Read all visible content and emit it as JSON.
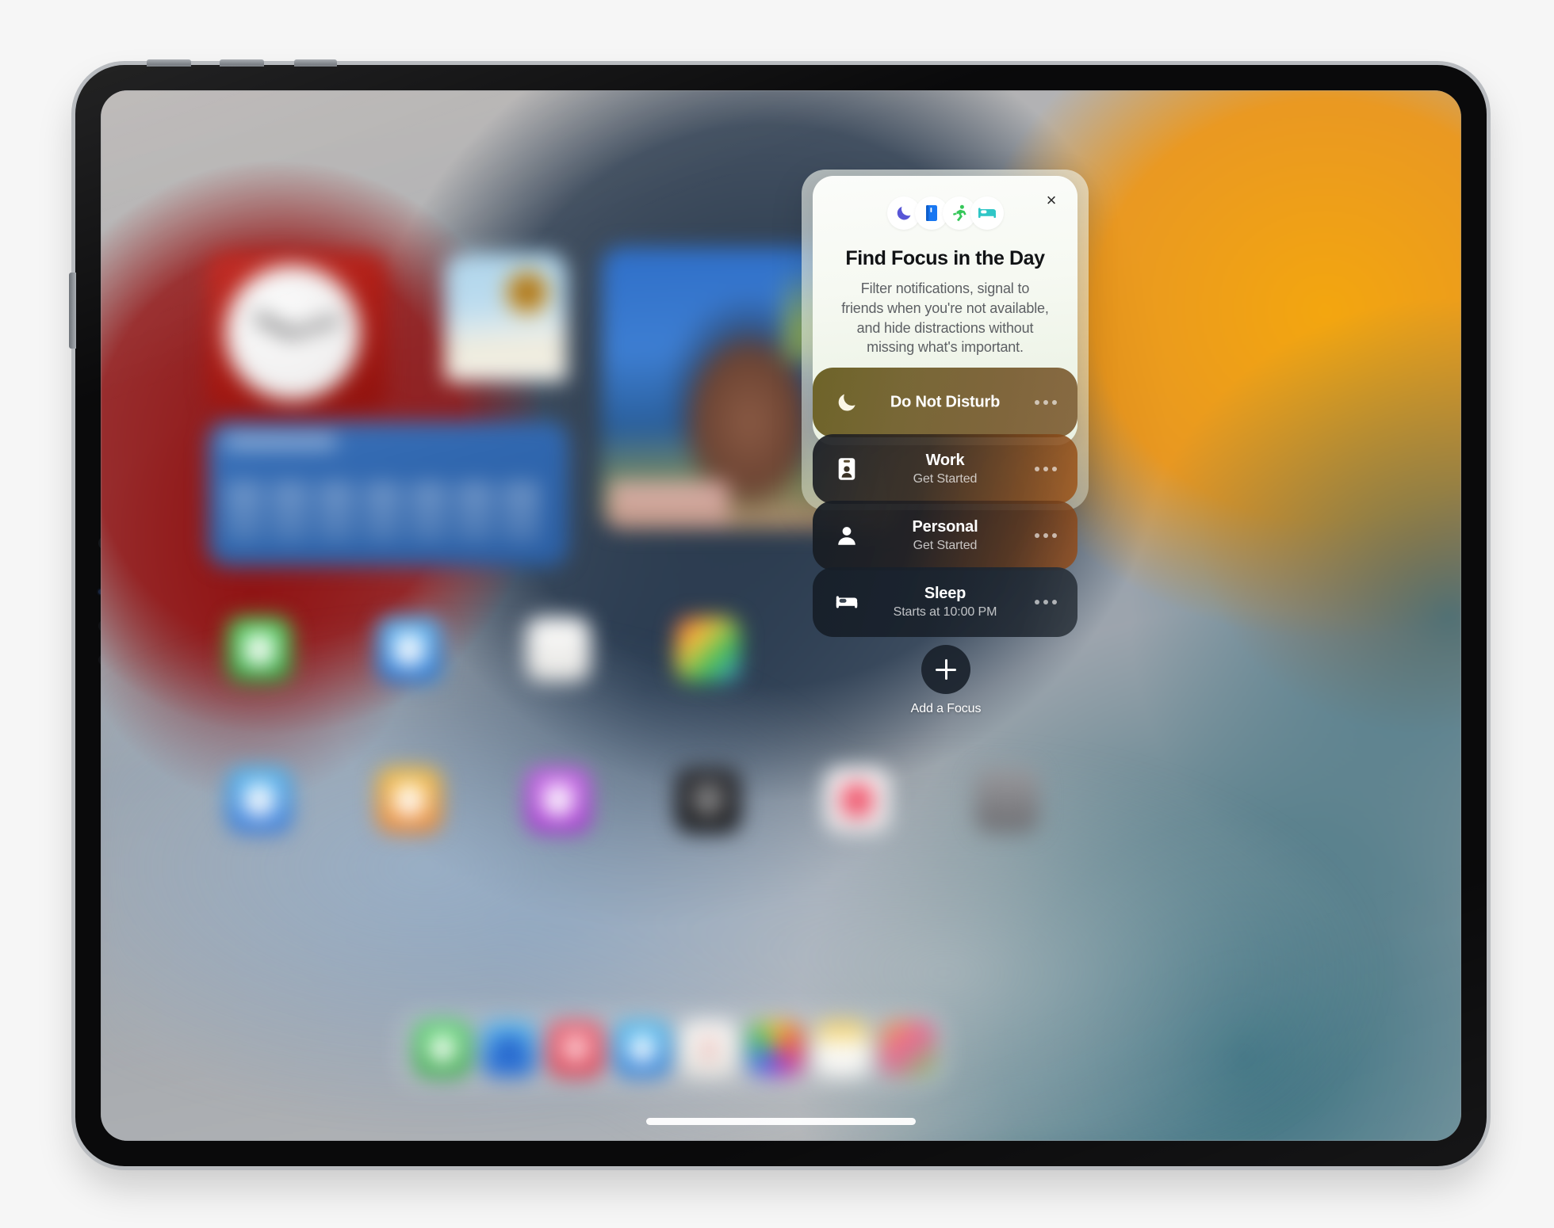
{
  "device": {
    "name": "iPad Pro",
    "top_buttons": [
      "top-button-1",
      "top-button-2",
      "top-button-3"
    ],
    "side_button": "side-button",
    "sensors": [
      "front-camera",
      "status-dot",
      "ambient-sensor",
      "ambient-sensor-2"
    ]
  },
  "card": {
    "title": "Find Focus in the Day",
    "description": "Filter notifications, signal to friends when you're not available, and hide distractions without missing what's important.",
    "close_label": "×",
    "icons": [
      {
        "name": "moon-icon",
        "color": "#5856D6"
      },
      {
        "name": "book-icon",
        "color": "#1877F2"
      },
      {
        "name": "running-icon",
        "color": "#35C759"
      },
      {
        "name": "bed-icon",
        "color": "#2FC6C6"
      }
    ]
  },
  "focus_modes": [
    {
      "name": "Do Not Disturb",
      "subtitle": "",
      "icon": "moon-icon",
      "more_label": "•••"
    },
    {
      "name": "Work",
      "subtitle": "Get Started",
      "icon": "id-badge-icon",
      "more_label": "•••"
    },
    {
      "name": "Personal",
      "subtitle": "Get Started",
      "icon": "person-icon",
      "more_label": "•••"
    },
    {
      "name": "Sleep",
      "subtitle": "Starts at 10:00 PM",
      "icon": "bed-icon",
      "more_label": "•••"
    }
  ],
  "add_focus": {
    "label": "Add a Focus",
    "icon": "plus-icon"
  },
  "homescreen": {
    "widgets": [
      {
        "name": "clock-widget",
        "color": "#B01C15"
      },
      {
        "name": "weather-widget",
        "color": "#AED4EA"
      },
      {
        "name": "forecast-widget",
        "color": "#2F66AE"
      },
      {
        "name": "photos-widget",
        "color": "#3D7ED2"
      }
    ],
    "app_icons": [
      {
        "name": "messages-app",
        "color": "#3ABB4E"
      },
      {
        "name": "facetime-app",
        "color": "#2E8BE8"
      },
      {
        "name": "notes-app",
        "color": "#F4F3F0"
      },
      {
        "name": "keynote-app",
        "color": "#D8D9DB"
      },
      {
        "name": "appstore-app",
        "color": "#2F8BEC"
      },
      {
        "name": "mail-app",
        "color": "#EE8C28"
      },
      {
        "name": "podcasts-app",
        "color": "#B43CDB"
      },
      {
        "name": "camera-app",
        "color": "#1C1C1E"
      },
      {
        "name": "health-app",
        "color": "#F5F4F5"
      },
      {
        "name": "settings-app",
        "color": "#8A8A8E"
      }
    ],
    "dock_icons": [
      {
        "name": "messages-dock-app",
        "color": "#3ABB4E"
      },
      {
        "name": "safari-dock-app",
        "color": "#2D7FE0"
      },
      {
        "name": "music-dock-app",
        "color": "#E8485C"
      },
      {
        "name": "mail-dock-app",
        "color": "#2B97E8"
      },
      {
        "name": "notes-dock-app",
        "color": "#F3F2EF"
      },
      {
        "name": "photos-dock-app",
        "color": "#E8643A"
      },
      {
        "name": "files-dock-app",
        "color": "#F2C63C"
      },
      {
        "name": "shortcuts-dock-app",
        "color": "#E8A23A"
      }
    ],
    "home_indicator": "home-indicator"
  },
  "colors": {
    "page_background": "#F6F6F6",
    "device_frame": "#B9BCC0",
    "bezel": "#0A0A0B",
    "card_background": "#F6F9F2",
    "accent_blue": "#1877F2",
    "accent_green": "#35C759",
    "accent_teal": "#2FC6C6",
    "accent_indigo": "#5856D6"
  }
}
